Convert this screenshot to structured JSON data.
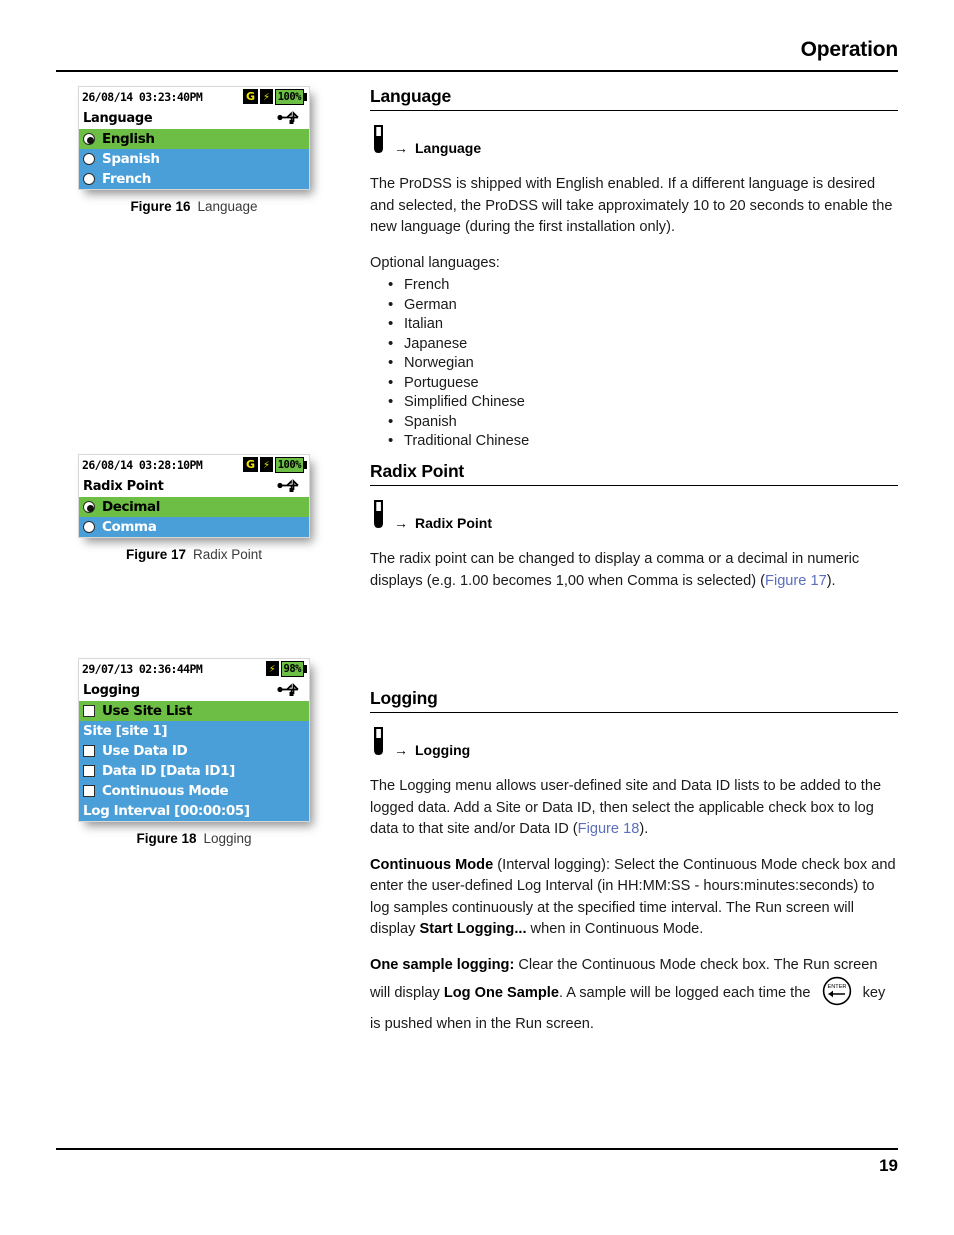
{
  "header": {
    "title": "Operation"
  },
  "footer": {
    "page_number": "19"
  },
  "figures": [
    {
      "id": "figure-16",
      "caption_label": "Figure 16",
      "caption_text": "Language",
      "screen": {
        "datetime": "26/08/14  03:23:40PM",
        "status": {
          "gps": "G",
          "charging": "⚡",
          "battery": "100%"
        },
        "title": "Language",
        "usb_icon": "usb-icon",
        "rows": [
          {
            "type": "radio",
            "label": "English",
            "selected": true,
            "highlighted": true
          },
          {
            "type": "radio",
            "label": "Spanish",
            "selected": false,
            "highlighted": false
          },
          {
            "type": "radio",
            "label": "French",
            "selected": false,
            "highlighted": false
          }
        ]
      }
    },
    {
      "id": "figure-17",
      "caption_label": "Figure 17",
      "caption_text": "Radix Point",
      "screen": {
        "datetime": "26/08/14  03:28:10PM",
        "status": {
          "gps": "G",
          "charging": "⚡",
          "battery": "100%"
        },
        "title": "Radix Point",
        "usb_icon": "usb-icon",
        "rows": [
          {
            "type": "radio",
            "label": "Decimal",
            "selected": true,
            "highlighted": true
          },
          {
            "type": "radio",
            "label": "Comma",
            "selected": false,
            "highlighted": false
          }
        ]
      }
    },
    {
      "id": "figure-18",
      "caption_label": "Figure 18",
      "caption_text": "Logging",
      "screen": {
        "datetime": "29/07/13  02:36:44PM",
        "status": {
          "gps": "",
          "charging": "⚡",
          "battery": "98%"
        },
        "title": "Logging",
        "usb_icon": "usb-icon",
        "rows": [
          {
            "type": "checkbox",
            "label": "Use Site List",
            "checked": false,
            "highlighted": true
          },
          {
            "type": "text",
            "label": "Site [site 1]",
            "highlighted": false
          },
          {
            "type": "checkbox",
            "label": "Use Data ID",
            "checked": false,
            "highlighted": false
          },
          {
            "type": "checkbox",
            "label": "Data ID [Data ID1]",
            "checked": false,
            "highlighted": false
          },
          {
            "type": "checkbox",
            "label": "Continuous Mode",
            "checked": false,
            "highlighted": false
          },
          {
            "type": "text",
            "label": "Log Interval [00:00:05]",
            "highlighted": false
          }
        ]
      }
    }
  ],
  "sections": {
    "language": {
      "heading": "Language",
      "nav": {
        "icon": "probe-icon",
        "arrow": "→",
        "label": "Language"
      },
      "paragraph": "The ProDSS is shipped with English enabled. If a different language is desired and selected, the ProDSS will take approximately 10 to 20 seconds to enable the new language (during the first installation only).",
      "optional_intro": "Optional languages:",
      "optional_languages": [
        "French",
        "German",
        "Italian",
        "Japanese",
        "Norwegian",
        "Portuguese",
        "Simplified Chinese",
        "Spanish",
        "Traditional Chinese"
      ]
    },
    "radix": {
      "heading": "Radix Point",
      "nav": {
        "icon": "probe-icon",
        "arrow": "→",
        "label": "Radix Point"
      },
      "paragraph_pre": "The radix point can be changed to display a comma or a decimal in numeric displays (e.g. 1.00 becomes 1,00 when Comma is selected) (",
      "paragraph_link": "Figure 17",
      "paragraph_post": ")."
    },
    "logging": {
      "heading": "Logging",
      "nav": {
        "icon": "probe-icon",
        "arrow": "→",
        "label": "Logging"
      },
      "intro_pre": "The Logging menu allows user-defined site and Data ID lists to be added to the logged data. Add a Site or Data ID, then select the applicable check box to log data to that site and/or Data ID (",
      "intro_link": "Figure 18",
      "intro_post": ").",
      "continuous_label": "Continuous Mode",
      "continuous_pre": " (Interval logging): Select the Continuous Mode check box and enter the user-defined Log Interval (in HH:MM:SS - hours:minutes:seconds) to log samples continuously at the specified time interval. The Run screen will display ",
      "continuous_bold": "Start Logging...",
      "continuous_post": " when in Continuous Mode.",
      "one_sample_label": "One sample logging:",
      "one_sample_pre": " Clear the Continuous Mode check box. The Run screen will display ",
      "one_sample_bold": "Log One Sample",
      "one_sample_mid": ". A sample will be logged each time the ",
      "one_sample_key": "ENTER",
      "one_sample_post": " key is pushed when in the Run screen."
    }
  },
  "colors": {
    "selected_row": "#6cbe45",
    "menu_row": "#4a9fd8",
    "link": "#5a6ebd",
    "badge_text": "#f2e300"
  }
}
